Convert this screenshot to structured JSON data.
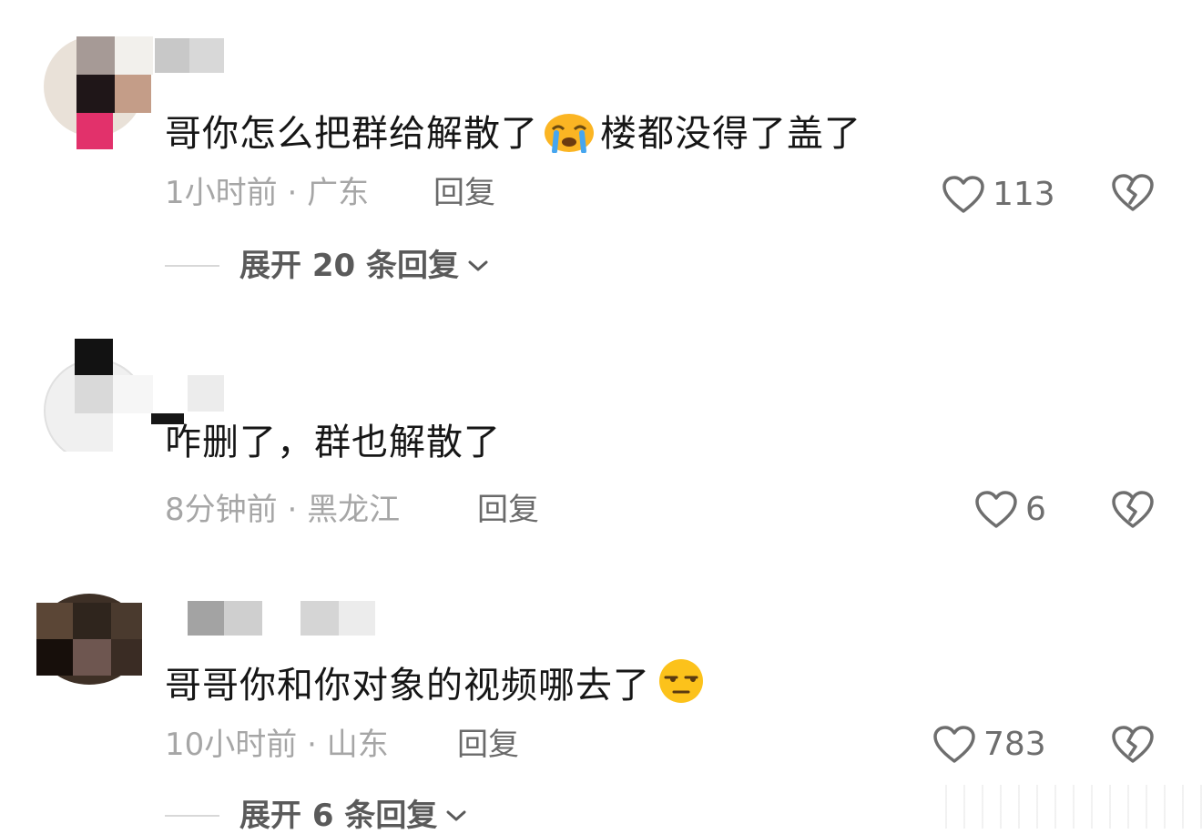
{
  "comments": [
    {
      "text_before": "哥你怎么把群给解散了",
      "emoji": "crying-face-emoji",
      "text_after": "楼都没得了盖了",
      "time": "1小时前",
      "location": "广东",
      "reply_label": "回复",
      "likes": "113",
      "expand_label": "展开 20 条回复"
    },
    {
      "text": "咋删了，群也解散了",
      "time": "8分钟前",
      "location": "黑龙江",
      "reply_label": "回复",
      "likes": "6"
    },
    {
      "text_before": "哥哥你和你对象的视频哪去了",
      "emoji": "unamused-face-emoji",
      "time": "10小时前",
      "location": "山东",
      "reply_label": "回复",
      "likes": "783",
      "expand_label": "展开 6 条回复"
    }
  ],
  "separator": "·",
  "colors": {
    "background": "#ffffff",
    "text": "#161616",
    "meta": "#a6a6a6",
    "icon": "#6e6e6e"
  }
}
